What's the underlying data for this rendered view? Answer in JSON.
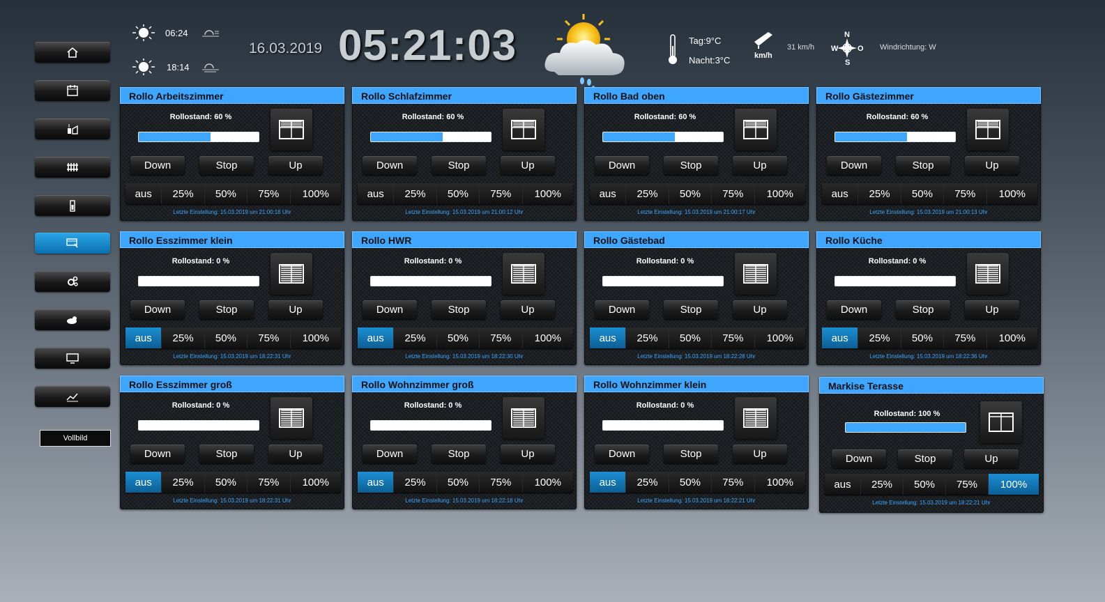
{
  "header": {
    "sunrise": "06:24",
    "sunset": "18:14",
    "date": "16.03.2019",
    "time": "05:21:03",
    "temp_day": "Tag:9°C",
    "temp_night": "Nacht:3°C",
    "wind_unit": "km/h",
    "wind_speed": "31 km/h",
    "compass": {
      "n": "N",
      "s": "S",
      "w": "W",
      "o": "O"
    },
    "wind_direction": "Windrichtung: W",
    "icons": [
      "sunrise-icon",
      "sunset-icon",
      "weather-icon",
      "thermometer-icon",
      "wind-gauge-icon",
      "compass-icon"
    ]
  },
  "sidebar": {
    "items": [
      {
        "icon": "home-icon"
      },
      {
        "icon": "calendar-icon"
      },
      {
        "icon": "energy-icon"
      },
      {
        "icon": "heating-icon"
      },
      {
        "icon": "battery-icon"
      },
      {
        "icon": "shutter-icon",
        "active": true
      },
      {
        "icon": "settings-icon"
      },
      {
        "icon": "weather-icon"
      },
      {
        "icon": "monitor-icon"
      },
      {
        "icon": "chart-icon"
      }
    ],
    "fullscreen": "Vollbild"
  },
  "labels": {
    "down": "Down",
    "stop": "Stop",
    "up": "Up",
    "presets": [
      "aus",
      "25%",
      "50%",
      "75%",
      "100%"
    ]
  },
  "cards": [
    {
      "title": "Rollo Arbeitszimmer",
      "stand": "Rollostand: 60 %",
      "level": 0.6,
      "active": null,
      "last": "Letzte Einstellung: 15.03.2019 um 21:00:18 Uhr"
    },
    {
      "title": "Rollo Schlafzimmer",
      "stand": "Rollostand: 60 %",
      "level": 0.6,
      "active": null,
      "last": "Letzte Einstellung: 15.03.2019 um 21:00:12 Uhr"
    },
    {
      "title": "Rollo Bad oben",
      "stand": "Rollostand: 60 %",
      "level": 0.6,
      "active": null,
      "last": "Letzte Einstellung: 15.03.2019 um 21:00:17 Uhr"
    },
    {
      "title": "Rollo Gästezimmer",
      "stand": "Rollostand: 60 %",
      "level": 0.6,
      "active": null,
      "last": "Letzte Einstellung: 15.03.2019 um 21:00:13 Uhr"
    },
    {
      "title": "Rollo Esszimmer klein",
      "stand": "Rollostand: 0 %",
      "level": 0,
      "active": 0,
      "last": "Letzte Einstellung: 15.03.2019 um 18:22:31 Uhr"
    },
    {
      "title": "Rollo HWR",
      "stand": "Rollostand: 0 %",
      "level": 0,
      "active": 0,
      "last": "Letzte Einstellung: 15.03.2019 um 18:22:30 Uhr"
    },
    {
      "title": "Rollo Gästebad",
      "stand": "Rollostand: 0 %",
      "level": 0,
      "active": 0,
      "last": "Letzte Einstellung: 15.03.2019 um 18:22:28 Uhr"
    },
    {
      "title": "Rollo Küche",
      "stand": "Rollostand: 0 %",
      "level": 0,
      "active": 0,
      "last": "Letzte Einstellung: 15.03.2019 um 18:22:36 Uhr"
    },
    {
      "title": "Rollo Esszimmer groß",
      "stand": "Rollostand: 0 %",
      "level": 0,
      "active": 0,
      "last": "Letzte Einstellung: 15.03.2019 um 18:22:31 Uhr"
    },
    {
      "title": "Rollo Wohnzimmer groß",
      "stand": "Rollostand: 0 %",
      "level": 0,
      "active": 0,
      "last": "Letzte Einstellung: 15.03.2019 um 18:22:18 Uhr"
    },
    {
      "title": "Rollo Wohnzimmer klein",
      "stand": "Rollostand: 0 %",
      "level": 0,
      "active": 0,
      "last": "Letzte Einstellung: 15.03.2019 um 18:22:21 Uhr"
    },
    {
      "title": "Markise Terasse",
      "stand": "Rollostand: 100 %",
      "level": 1,
      "active": 4,
      "last": "Letzte Einstellung: 15.03.2019 um 18:22:21 Uhr"
    }
  ]
}
